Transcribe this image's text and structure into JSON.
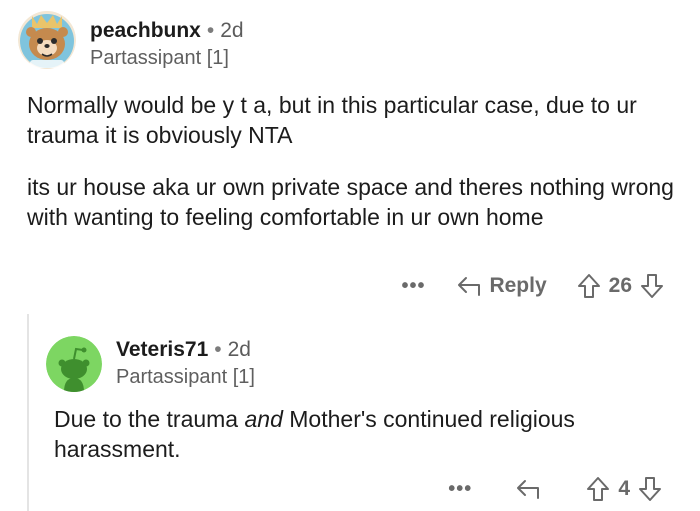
{
  "comment_parent": {
    "username": "peachbunx",
    "separator": "•",
    "time": "2d",
    "flair": "Partassipant [1]",
    "paragraphs": [
      "Normally would be y t a, but in this particular case, due to ur trauma it is obviously NTA",
      "its ur house aka ur own private space and theres nothing wrong with wanting to feeling comfortable in ur own home"
    ],
    "more_label": "•••",
    "reply_label": "Reply",
    "score": "26"
  },
  "comment_child": {
    "username": "Veteris71",
    "separator": "•",
    "time": "2d",
    "flair": "Partassipant [1]",
    "text_before": "Due to the trauma ",
    "text_emphasis": "and",
    "text_after": " Mother's continued religious harassment.",
    "more_label": "•••",
    "score": "4"
  },
  "colors": {
    "text": "#1c1c1c",
    "meta": "#5c5c5c",
    "action": "#6a6a6a",
    "avatar_green": "#7dd662"
  },
  "icons": [
    "peach-bear-avatar-icon",
    "snoo-avatar-icon",
    "reply-arrow-icon",
    "upvote-arrow-icon",
    "downvote-arrow-icon",
    "more-options-icon"
  ]
}
